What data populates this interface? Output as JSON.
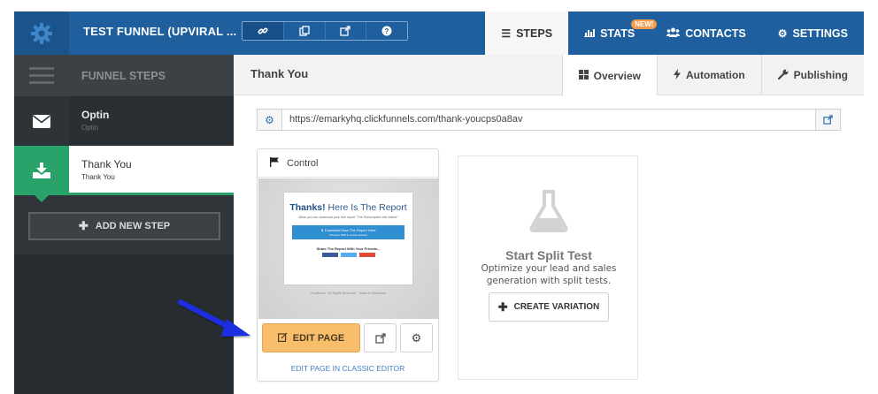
{
  "topbar": {
    "funnel_title": "TEST FUNNEL (UPVIRAL ...",
    "nav": [
      {
        "label": "STEPS",
        "icon": "list-icon"
      },
      {
        "label": "STATS",
        "icon": "bar-chart-icon",
        "badge": "NEW!"
      },
      {
        "label": "CONTACTS",
        "icon": "users-icon"
      },
      {
        "label": "SETTINGS",
        "icon": "gear-icon"
      }
    ],
    "active_nav": "STEPS"
  },
  "sidebar": {
    "title": "FUNNEL STEPS",
    "steps": [
      {
        "name": "Optin",
        "sub": "Optin",
        "icon": "envelope-icon"
      },
      {
        "name": "Thank You",
        "sub": "Thank You",
        "icon": "download-icon"
      }
    ],
    "add_step_label": "ADD NEW STEP"
  },
  "main": {
    "page_name": "Thank You",
    "tabs": [
      {
        "label": "Overview",
        "icon": "grid-icon"
      },
      {
        "label": "Automation",
        "icon": "bolt-icon"
      },
      {
        "label": "Publishing",
        "icon": "wrench-icon"
      }
    ],
    "active_tab": "Overview",
    "url": "https://emarkyhq.clickfunnels.com/thank-youcps0a8av",
    "variant": {
      "label": "Control",
      "preview": {
        "headline_bold": "Thanks!",
        "headline_rest": " Here Is The Report",
        "subtext": "Allow you can download your free report \"The Subscription Info Matrix\"",
        "button": "⬇ Download Now The Report Here",
        "button_sub": "(it'll open PDF in a new window)",
        "share": "Share The Report With Your Friends...",
        "footer": "YourBrand · All Rights Reserved · Terms & Disclaimer"
      },
      "edit_label": "EDIT PAGE",
      "classic_link": "EDIT PAGE IN CLASSIC EDITOR"
    },
    "split_test": {
      "title": "Start Split Test",
      "description": "Optimize your lead and sales generation with split tests.",
      "create_label": "CREATE VARIATION"
    }
  },
  "colors": {
    "topbar": "#1f5f9e",
    "sidebar": "#2f3539",
    "active_step": "#29a36a",
    "edit_button": "#f8be6b",
    "badge": "#f39c4b",
    "arrow": "#1a2ee0"
  }
}
